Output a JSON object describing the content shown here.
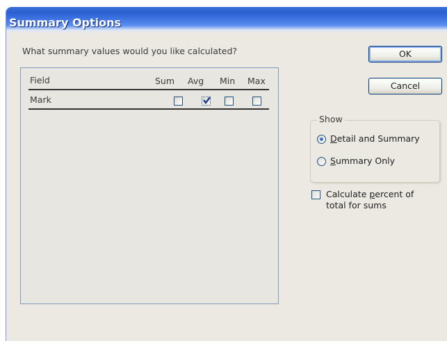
{
  "dialog": {
    "title": "Summary Options",
    "prompt": "What summary values would you like calculated?"
  },
  "grid": {
    "columns": {
      "field": "Field",
      "sum": "Sum",
      "avg": "Avg",
      "min": "Min",
      "max": "Max"
    },
    "rows": [
      {
        "field": "Mark",
        "sum": false,
        "avg": true,
        "min": false,
        "max": false
      }
    ]
  },
  "buttons": {
    "ok": "OK",
    "cancel": "Cancel"
  },
  "show_group": {
    "legend": "Show",
    "options": [
      {
        "accel": "D",
        "rest": "etail and Summary",
        "selected": true
      },
      {
        "accel": "S",
        "rest": "ummary Only",
        "selected": false
      }
    ]
  },
  "percent_option": {
    "line1_pre": "Calculate ",
    "line1_accel": "p",
    "line1_post": "ercent of",
    "line2": "total for sums",
    "checked": false
  },
  "colors": {
    "dialog_bg": "#ebe9e2",
    "title_blue": "#2a5fd0",
    "radio_dot": "#3b6fd0"
  }
}
